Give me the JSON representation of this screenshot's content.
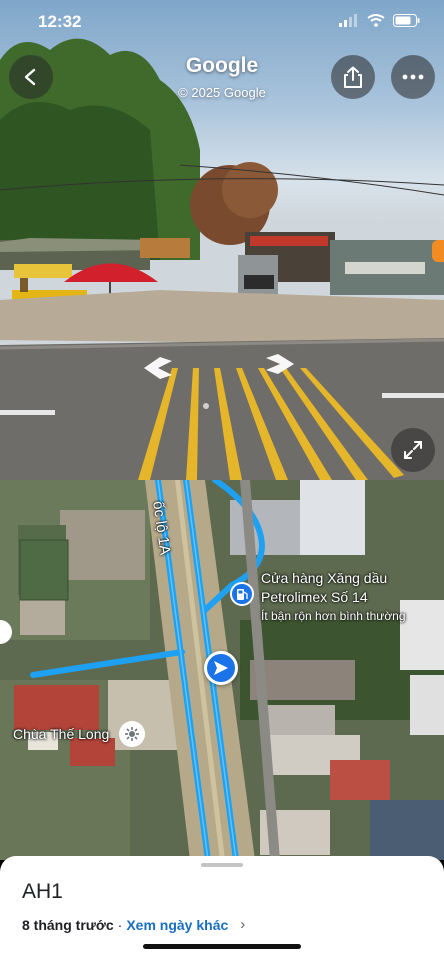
{
  "status_bar": {
    "time": "12:32"
  },
  "street_view": {
    "title": "Google",
    "copyright": "© 2025 Google",
    "buttons": {
      "back_icon": "chevron-left-icon",
      "share_icon": "share-icon",
      "more_icon": "more-horizontal-icon",
      "expand_icon": "expand-icon"
    }
  },
  "map": {
    "road_label": "ốc lộ 1A",
    "poi": {
      "name_line1": "Cửa hàng Xăng dầu",
      "name_line2": "Petrolimex Số 14",
      "busy_text": "Ít bận rộn hơn bình thường",
      "icon": "gas-station-icon"
    },
    "temple": {
      "name": "Chùa Thế Long",
      "icon": "temple-icon"
    },
    "colors": {
      "route": "#1ea1f2",
      "pegman": "#1a73e8"
    }
  },
  "sheet": {
    "place": "AH1",
    "age": "8 tháng trước",
    "separator": "·",
    "other_dates_link": "Xem ngày khác",
    "chevron": "›"
  }
}
